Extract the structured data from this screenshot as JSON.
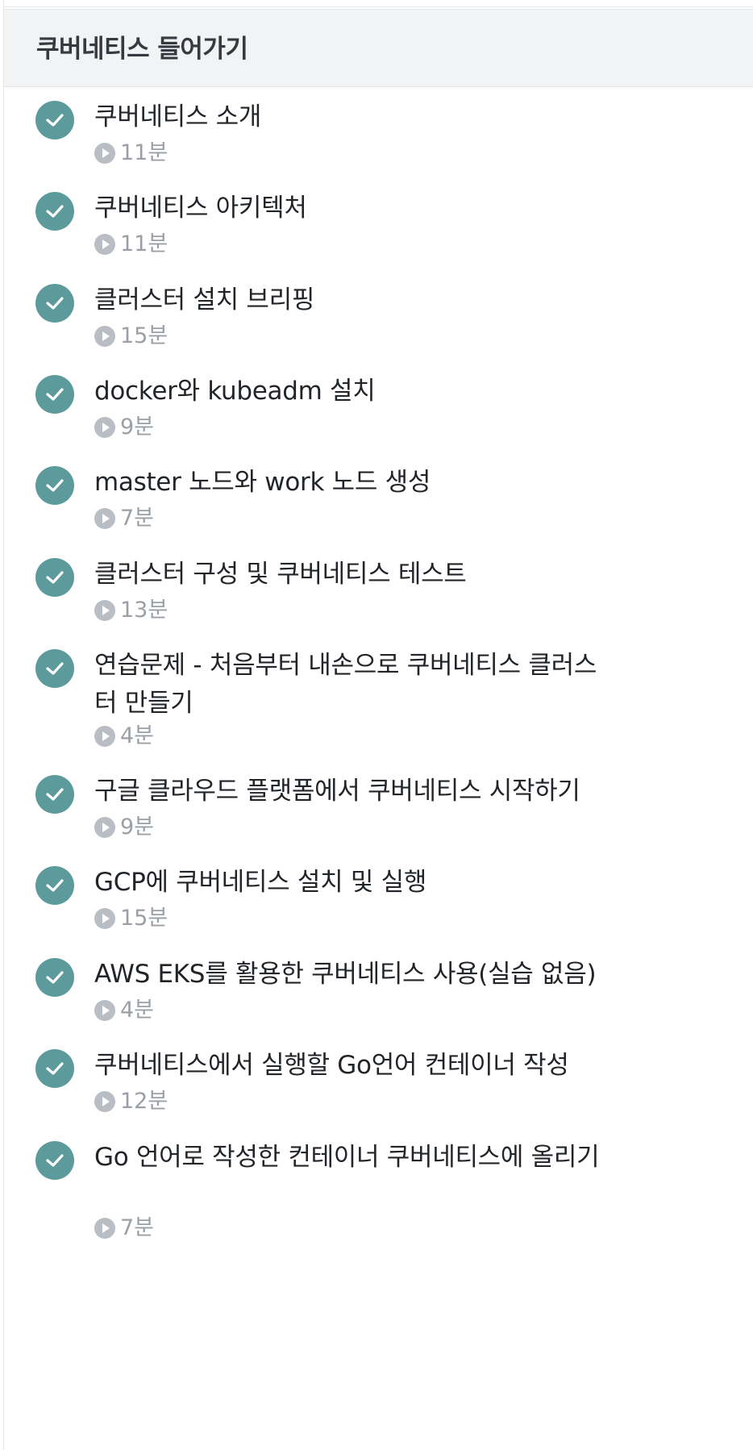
{
  "section": {
    "title": "쿠버네티스 들어가기"
  },
  "lessons": [
    {
      "title": "쿠버네티스 소개",
      "duration": "11분",
      "completed": true
    },
    {
      "title": "쿠버네티스 아키텍처",
      "duration": "11분",
      "completed": true
    },
    {
      "title": "클러스터 설치 브리핑",
      "duration": "15분",
      "completed": true
    },
    {
      "title": "docker와 kubeadm 설치",
      "duration": "9분",
      "completed": true
    },
    {
      "title": "master 노드와 work 노드 생성",
      "duration": "7분",
      "completed": true
    },
    {
      "title": "클러스터 구성 및 쿠버네티스 테스트",
      "duration": "13분",
      "completed": true
    },
    {
      "title": "연습문제 - 처음부터 내손으로 쿠버네티스 클러스터 만들기",
      "duration": "4분",
      "completed": true
    },
    {
      "title": "구글 클라우드 플랫폼에서 쿠버네티스 시작하기",
      "duration": "9분",
      "completed": true
    },
    {
      "title": "GCP에 쿠버네티스 설치 및 실행",
      "duration": "15분",
      "completed": true
    },
    {
      "title": "AWS EKS를 활용한 쿠버네티스 사용(실습 없음)",
      "duration": "4분",
      "completed": true
    },
    {
      "title": "쿠버네티스에서 실행할 Go언어 컨테이너 작성",
      "duration": "12분",
      "completed": true
    },
    {
      "title": "Go 언어로 작성한 컨테이너 쿠버네티스에 올리기",
      "duration": "7분",
      "completed": true
    }
  ],
  "colors": {
    "check_bg": "#5c9a9b",
    "header_bg": "#f1f3f5",
    "title_text": "#212529",
    "meta_text": "#9aa0a6"
  },
  "icons": {
    "completed": "check-circle-icon",
    "video": "play-circle-icon"
  }
}
